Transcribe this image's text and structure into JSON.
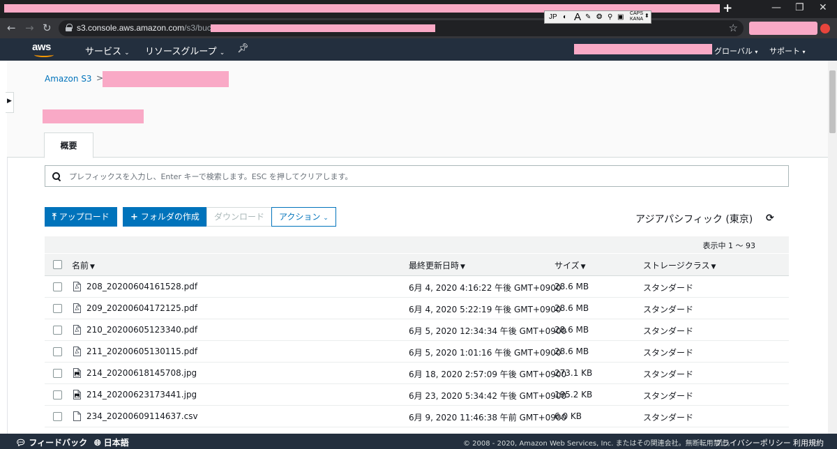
{
  "browser": {
    "url_host": "s3.console.aws.amazon.com",
    "url_path": "/s3/buckets",
    "ime": {
      "lang": "JP",
      "caps": "CAPS",
      "kana": "KANA"
    }
  },
  "nav": {
    "logo": "aws",
    "services": "サービス",
    "resource_groups": "リソースグループ",
    "region": "グローバル",
    "support": "サポート"
  },
  "breadcrumb": {
    "root": "Amazon S3",
    "separator": ">"
  },
  "tabs": {
    "overview": "概要"
  },
  "search": {
    "placeholder": "プレフィックスを入力し、Enter キーで検索します。ESC を押してクリアします。"
  },
  "actions": {
    "upload": "アップロード",
    "create_folder": "フォルダの作成",
    "download": "ダウンロード",
    "actions": "アクション",
    "region_name": "アジアパシフィック (東京)"
  },
  "table": {
    "count_text": "表示中 1 ～ 93",
    "columns": {
      "name": "名前",
      "modified": "最終更新日時",
      "size": "サイズ",
      "storage": "ストレージクラス"
    },
    "rows": [
      {
        "type": "pdf",
        "name": "208_20200604161528.pdf",
        "modified": "6月 4, 2020 4:16:22 午後 GMT+0900",
        "size": "28.6 MB",
        "storage": "スタンダード"
      },
      {
        "type": "pdf",
        "name": "209_20200604172125.pdf",
        "modified": "6月 4, 2020 5:22:19 午後 GMT+0900",
        "size": "28.6 MB",
        "storage": "スタンダード"
      },
      {
        "type": "pdf",
        "name": "210_20200605123340.pdf",
        "modified": "6月 5, 2020 12:34:34 午後 GMT+0900",
        "size": "28.6 MB",
        "storage": "スタンダード"
      },
      {
        "type": "pdf",
        "name": "211_20200605130115.pdf",
        "modified": "6月 5, 2020 1:01:16 午後 GMT+0900",
        "size": "28.6 MB",
        "storage": "スタンダード"
      },
      {
        "type": "image",
        "name": "214_20200618145708.jpg",
        "modified": "6月 18, 2020 2:57:09 午後 GMT+0900",
        "size": "273.1 KB",
        "storage": "スタンダード"
      },
      {
        "type": "image",
        "name": "214_20200623173441.jpg",
        "modified": "6月 23, 2020 5:34:42 午後 GMT+0900",
        "size": "195.2 KB",
        "storage": "スタンダード"
      },
      {
        "type": "csv",
        "name": "234_20200609114637.csv",
        "modified": "6月 9, 2020 11:46:38 午前 GMT+0900",
        "size": "6.0 KB",
        "storage": "スタンダード"
      }
    ]
  },
  "footer": {
    "feedback": "フィードバック",
    "language": "日本語",
    "copyright": "© 2008 - 2020, Amazon Web Services, Inc. またはその関連会社。無断転用禁止。",
    "privacy": "プライバシーポリシー",
    "terms": "利用規約"
  },
  "colors": {
    "nav_bg": "#232f3e",
    "primary": "#0073bb",
    "accent": "#ff9900"
  }
}
